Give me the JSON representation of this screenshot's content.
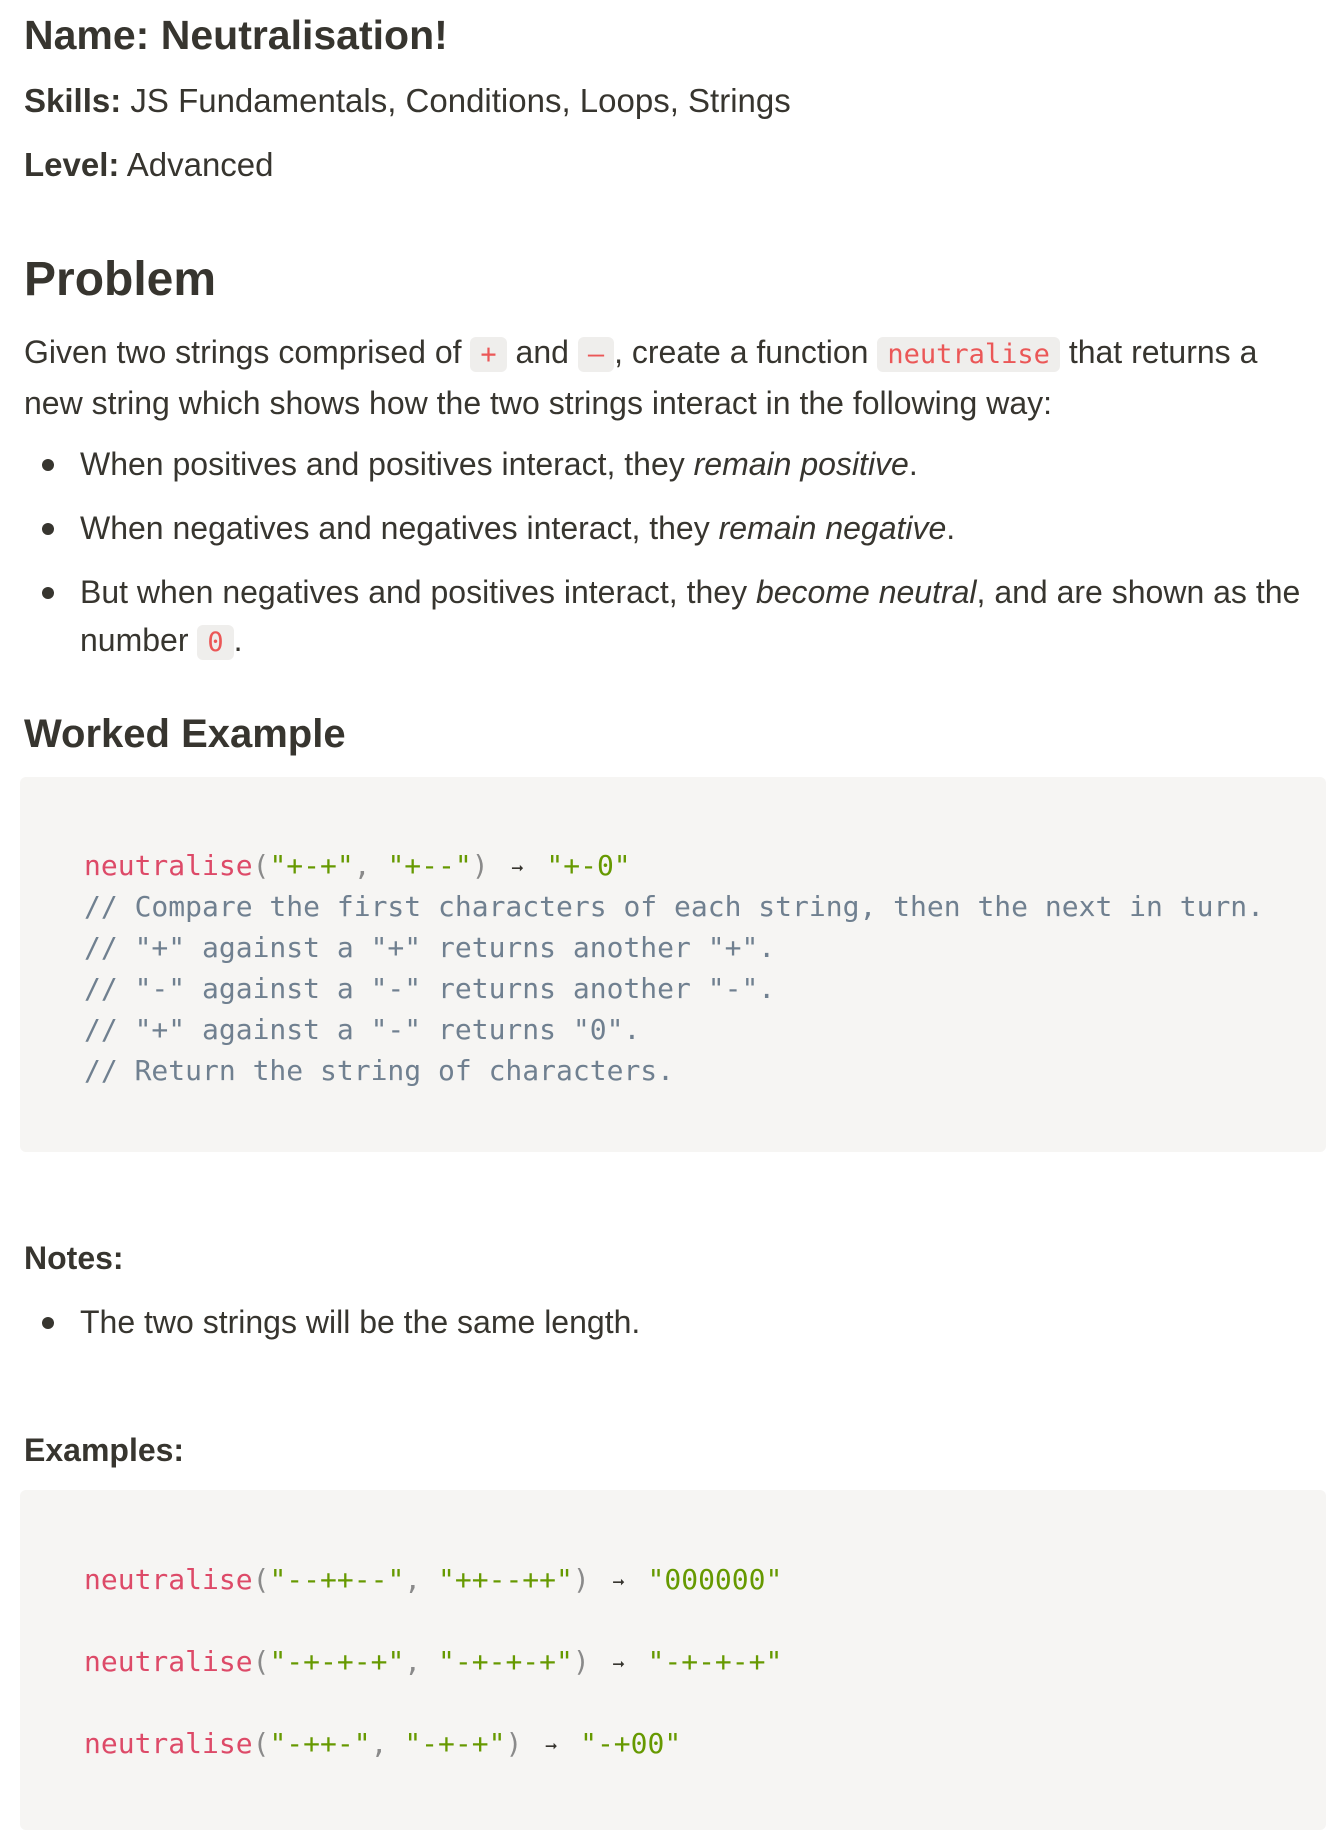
{
  "meta": {
    "name_label": "Name:",
    "name_value": "Neutralisation!",
    "skills_label": "Skills:",
    "skills_value": "JS Fundamentals, Conditions, Loops, Strings",
    "level_label": "Level:",
    "level_value": "Advanced"
  },
  "problem": {
    "heading": "Problem",
    "intro": {
      "t1": "Given two strings comprised of",
      "plus": "+",
      "t2": "and",
      "minus": "–",
      "t3": ", create a function",
      "fn": "neutralise",
      "t4": "that returns a new string which shows how the two strings interact in the following way:"
    },
    "bullets": [
      {
        "pre": "When positives and positives interact, they ",
        "em": "remain positive",
        "post": "."
      },
      {
        "pre": "When negatives and negatives interact, they ",
        "em": "remain negative",
        "post": "."
      },
      {
        "pre": "But when negatives and positives interact, they ",
        "em": "become neutral",
        "mid": ", and are shown as the number ",
        "code": "0",
        "post": "."
      }
    ]
  },
  "worked": {
    "heading": "Worked Example",
    "call": {
      "fn": "neutralise",
      "open": "(",
      "arg1": "\"+-+\"",
      "comma": ", ",
      "arg2": "\"+--\"",
      "close": ")",
      "arrow": "➞",
      "result": "\"+-0\""
    },
    "comments": [
      "// Compare the first characters of each string, then the next in turn.",
      "// \"+\" against a \"+\" returns another \"+\".",
      "// \"-\" against a \"-\" returns another \"-\".",
      "// \"+\" against a \"-\" returns \"0\".",
      "// Return the string of characters."
    ]
  },
  "notes": {
    "heading": "Notes:",
    "items": [
      "The two strings will be the same length."
    ]
  },
  "examples": {
    "heading": "Examples:",
    "items": [
      {
        "fn": "neutralise",
        "open": "(",
        "arg1": "\"--++--\"",
        "comma": ", ",
        "arg2": "\"++--++\"",
        "close": ")",
        "arrow": "➞",
        "result": "\"000000\""
      },
      {
        "fn": "neutralise",
        "open": "(",
        "arg1": "\"-+-+-+\"",
        "comma": ", ",
        "arg2": "\"-+-+-+\"",
        "close": ")",
        "arrow": "➞",
        "result": "\"-+-+-+\""
      },
      {
        "fn": "neutralise",
        "open": "(",
        "arg1": "\"-++-\"",
        "comma": ", ",
        "arg2": "\"-+-+\"",
        "close": ")",
        "arrow": "➞",
        "result": "\"-+00\""
      }
    ]
  }
}
